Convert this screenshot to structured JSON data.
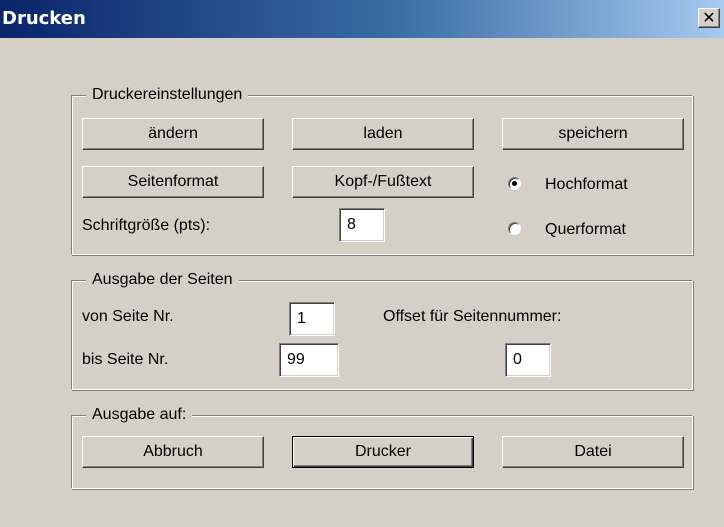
{
  "window": {
    "title": "Drucken",
    "close_glyph": "✕"
  },
  "printer_settings": {
    "label": "Druckereinstellungen",
    "change": "ändern",
    "load": "laden",
    "save": "speichern",
    "page_format": "Seitenformat",
    "header_footer": "Kopf-/Fußtext",
    "font_size_label": "Schriftgröße (pts):",
    "font_size_value": "8",
    "orientation": {
      "portrait": "Hochformat",
      "landscape": "Querformat",
      "selected": "portrait"
    }
  },
  "pages": {
    "label": "Ausgabe der Seiten",
    "from_label": "von Seite Nr.",
    "from_value": "1",
    "to_label": "bis Seite Nr.",
    "to_value": "99",
    "offset_label": "Offset für Seitennummer:",
    "offset_value": "0"
  },
  "output": {
    "label": "Ausgabe auf:",
    "cancel": "Abbruch",
    "printer": "Drucker",
    "file": "Datei"
  }
}
